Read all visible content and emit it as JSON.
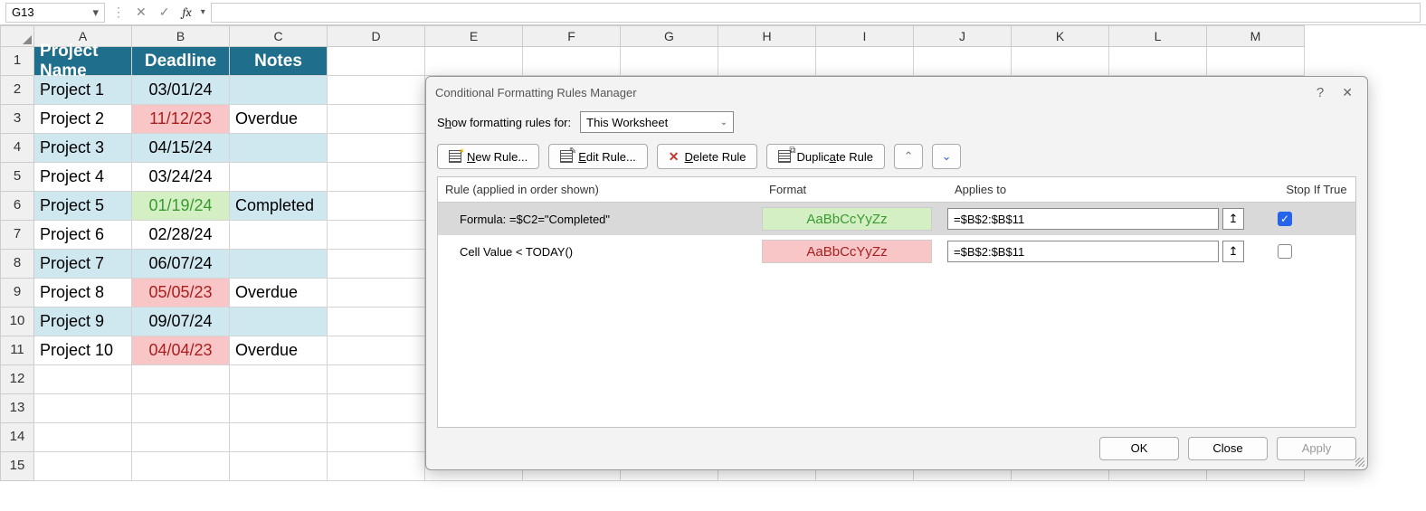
{
  "formula_bar": {
    "name_box": "G13",
    "fx": "fx"
  },
  "columns": [
    "A",
    "B",
    "C",
    "D",
    "E",
    "F",
    "G",
    "H",
    "I",
    "J",
    "K",
    "L",
    "M"
  ],
  "row_numbers": [
    "1",
    "2",
    "3",
    "4",
    "5",
    "6",
    "7",
    "8",
    "9",
    "10",
    "11",
    "12",
    "13",
    "14",
    "15"
  ],
  "headers": {
    "a": "Project Name",
    "b": "Deadline",
    "c": "Notes"
  },
  "rows": [
    {
      "name": "Project 1",
      "deadline": "03/01/24",
      "note": "",
      "stripe": true,
      "fmt": ""
    },
    {
      "name": "Project 2",
      "deadline": "11/12/23",
      "note": "Overdue",
      "stripe": false,
      "fmt": "red"
    },
    {
      "name": "Project 3",
      "deadline": "04/15/24",
      "note": "",
      "stripe": true,
      "fmt": ""
    },
    {
      "name": "Project 4",
      "deadline": "03/24/24",
      "note": "",
      "stripe": false,
      "fmt": ""
    },
    {
      "name": "Project 5",
      "deadline": "01/19/24",
      "note": "Completed",
      "stripe": true,
      "fmt": "green"
    },
    {
      "name": "Project 6",
      "deadline": "02/28/24",
      "note": "",
      "stripe": false,
      "fmt": ""
    },
    {
      "name": "Project 7",
      "deadline": "06/07/24",
      "note": "",
      "stripe": true,
      "fmt": ""
    },
    {
      "name": "Project 8",
      "deadline": "05/05/23",
      "note": "Overdue",
      "stripe": false,
      "fmt": "red"
    },
    {
      "name": "Project 9",
      "deadline": "09/07/24",
      "note": "",
      "stripe": true,
      "fmt": ""
    },
    {
      "name": "Project 10",
      "deadline": "04/04/23",
      "note": "Overdue",
      "stripe": false,
      "fmt": "red"
    }
  ],
  "dialog": {
    "title": "Conditional Formatting Rules Manager",
    "show_label_pre": "S",
    "show_label_u": "h",
    "show_label_post": "ow formatting rules for:",
    "show_value": "This Worksheet",
    "btn_new": "New Rule...",
    "btn_new_u": "N",
    "btn_edit": "Edit Rule...",
    "btn_edit_u": "E",
    "btn_delete": "Delete Rule",
    "btn_delete_u": "D",
    "btn_dup": "Duplicate Rule",
    "btn_dup_u": "a",
    "col_rule": "Rule (applied in order shown)",
    "col_fmt": "Format",
    "col_app": "Applies to",
    "col_stop": "Stop If True",
    "rules": [
      {
        "desc": "Formula: =$C2=\"Completed\"",
        "preview": "AaBbCcYyZz",
        "cls": "fmt-green",
        "applies": "=$B$2:$B$11",
        "stop": true,
        "sel": true
      },
      {
        "desc": "Cell Value < TODAY()",
        "preview": "AaBbCcYyZz",
        "cls": "fmt-red",
        "applies": "=$B$2:$B$11",
        "stop": false,
        "sel": false
      }
    ],
    "ok": "OK",
    "close": "Close",
    "apply": "Apply"
  },
  "selected_cell": "G13"
}
